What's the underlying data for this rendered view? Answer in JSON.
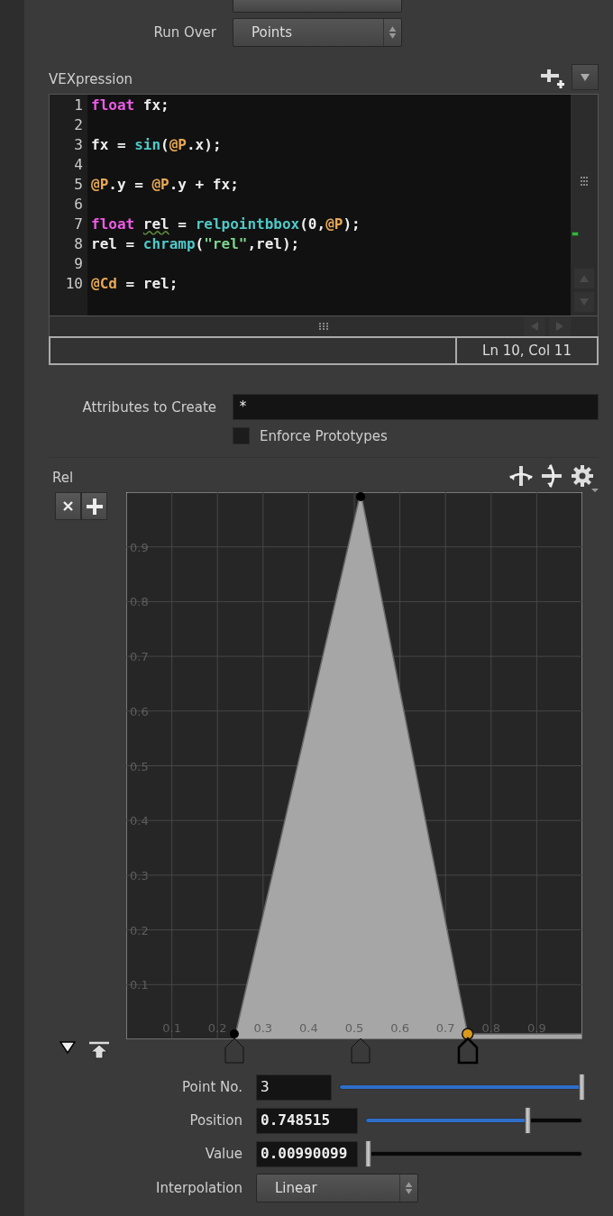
{
  "params_top": [
    {
      "kind": "stub"
    },
    {
      "kind": "dropdown",
      "label": "Run Over",
      "value": "Points"
    }
  ],
  "vexpression": {
    "label": "VEXpression",
    "lines": [
      {
        "number": "1",
        "tokens": [
          {
            "kind": "keyword",
            "text": "float"
          },
          {
            "kind": "plain",
            "text": " fx;"
          }
        ]
      },
      {
        "number": "2"
      },
      {
        "number": "3",
        "tokens": [
          {
            "kind": "plain",
            "text": "fx = "
          },
          {
            "kind": "function",
            "text": "sin"
          },
          {
            "kind": "plain",
            "text": "("
          },
          {
            "kind": "attribute",
            "text": "@P"
          },
          {
            "kind": "plain",
            "text": ".x);"
          }
        ]
      },
      {
        "number": "4"
      },
      {
        "number": "5",
        "tokens": [
          {
            "kind": "attribute",
            "text": "@P"
          },
          {
            "kind": "plain",
            "text": ".y = "
          },
          {
            "kind": "attribute",
            "text": "@P"
          },
          {
            "kind": "plain",
            "text": ".y + fx;"
          }
        ]
      },
      {
        "number": "6"
      },
      {
        "number": "7",
        "tokens": [
          {
            "kind": "keyword",
            "text": "float"
          },
          {
            "kind": "warning",
            "text": "rel"
          },
          {
            "kind": "plain",
            "text": " = "
          },
          {
            "kind": "function",
            "text": "relpointbbox"
          },
          {
            "kind": "plain",
            "text": "(0,"
          },
          {
            "kind": "attribute",
            "text": "@P"
          },
          {
            "kind": "plain",
            "text": ");"
          }
        ]
      },
      {
        "number": "8",
        "tokens": [
          {
            "kind": "plain",
            "text": "rel = "
          },
          {
            "kind": "function",
            "text": "chramp"
          },
          {
            "kind": "plain",
            "text": "("
          },
          {
            "kind": "string",
            "text": "\"rel\""
          },
          {
            "kind": "plain",
            "text": ",rel);"
          }
        ]
      },
      {
        "number": "9"
      },
      {
        "number": "10",
        "tokens": [
          {
            "kind": "attribute",
            "text": "@Cd"
          },
          {
            "kind": "plain",
            "text": " = rel;"
          }
        ]
      }
    ],
    "status": "Ln 10, Col 11"
  },
  "attributes": {
    "label": "Attributes to Create",
    "value": "*"
  },
  "enforce_prototypes": {
    "label": "Enforce Prototypes",
    "checked": false
  },
  "ramp": {
    "label": "Rel",
    "chart_data": {
      "type": "area",
      "x": [
        0,
        0.237,
        0.514,
        0.748515,
        1
      ],
      "series": [
        {
          "color": "#a6a6a6",
          "values": [
            0,
            0,
            1,
            0.01,
            0.01
          ]
        }
      ],
      "grid": true,
      "xlim": [
        0,
        1
      ],
      "ylim": [
        0,
        1
      ],
      "xticks": [
        0.1,
        0.2,
        0.3,
        0.4,
        0.5,
        0.6,
        0.7,
        0.8,
        0.9
      ],
      "yticks": [
        0.1,
        0.2,
        0.3,
        0.4,
        0.5,
        0.6,
        0.7,
        0.8,
        0.9
      ]
    },
    "keys": [
      {
        "selected": false
      },
      {
        "selected": false
      },
      {
        "selected": true
      }
    ],
    "point_no": {
      "label": "Point No.",
      "value": "3",
      "level": 1
    },
    "position": {
      "label": "Position",
      "value": "0.748515",
      "level": 0.748515
    },
    "value": {
      "label": "Value",
      "value": "0.00990099",
      "level": 0.0099
    },
    "interpolation": {
      "label": "Interpolation",
      "value": "Linear"
    }
  }
}
